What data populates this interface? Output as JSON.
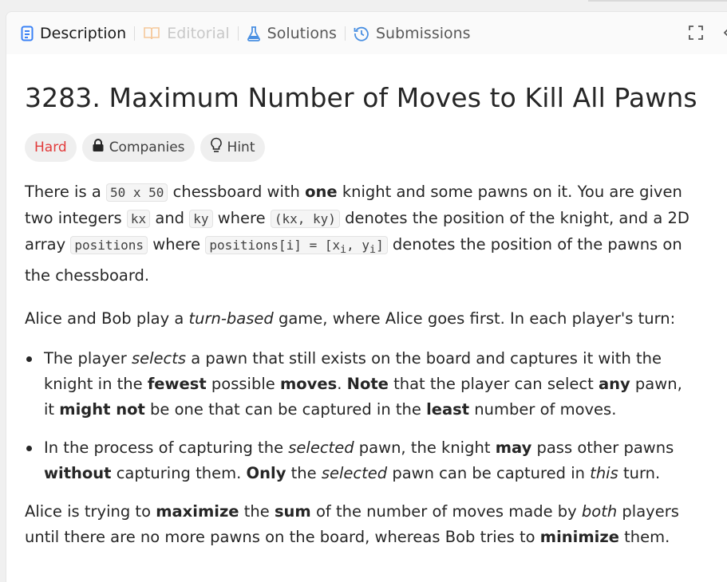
{
  "tabs": [
    {
      "label": "Description",
      "icon": "document-icon",
      "state": "active"
    },
    {
      "label": "Editorial",
      "icon": "book-icon",
      "state": "disabled"
    },
    {
      "label": "Solutions",
      "icon": "flask-icon",
      "state": "normal"
    },
    {
      "label": "Submissions",
      "icon": "history-icon",
      "state": "normal"
    }
  ],
  "problem": {
    "title": "3283. Maximum Number of Moves to Kill All Pawns",
    "difficulty": "Hard",
    "companies_label": "Companies",
    "hint_label": "Hint"
  },
  "text": {
    "p1_a": "There is a ",
    "p1_code1": "50 x 50",
    "p1_b": " chessboard with ",
    "p1_bold1": "one",
    "p1_c": " knight and some pawns on it. You are given two integers ",
    "p1_code2": "kx",
    "p1_d": " and ",
    "p1_code3": "ky",
    "p1_e": " where ",
    "p1_code4": "(kx, ky)",
    "p1_f": " denotes the position of the knight, and a 2D array ",
    "p1_code5": "positions",
    "p1_g": " where ",
    "p1_code6": "positions[i] = [x",
    "p1_sub1": "i",
    "p1_code7": ", y",
    "p1_sub2": "i",
    "p1_code8": "]",
    "p1_h": " denotes the position of the pawns on the chessboard.",
    "p2_a": "Alice and Bob play a ",
    "p2_i": "turn-based",
    "p2_b": " game, where Alice goes first. In each player's turn:",
    "b1_a": "The player ",
    "b1_i": "selects",
    "b1_b": " a pawn that still exists on the board and captures it with the knight in the ",
    "b1_bold1": "fewest",
    "b1_c": " possible ",
    "b1_bold2": "moves",
    "b1_d": ". ",
    "b1_bold3": "Note",
    "b1_e": " that the player can select ",
    "b1_bold4": "any",
    "b1_f": " pawn, it ",
    "b1_bold5": "might not",
    "b1_g": " be one that can be captured in the ",
    "b1_bold6": "least",
    "b1_h": " number of moves.",
    "b2_a": "In the process of capturing the ",
    "b2_i1": "selected",
    "b2_b": " pawn, the knight ",
    "b2_bold1": "may",
    "b2_c": " pass other pawns ",
    "b2_bold2": "without",
    "b2_d": " capturing them. ",
    "b2_bold3": "Only",
    "b2_e": " the ",
    "b2_i2": "selected",
    "b2_f": " pawn can be captured in ",
    "b2_i3": "this",
    "b2_g": " turn.",
    "p3_a": "Alice is trying to ",
    "p3_bold1": "maximize",
    "p3_b": " the ",
    "p3_bold2": "sum",
    "p3_c": " of the number of moves made by ",
    "p3_i": "both",
    "p3_d": " players until there are no more pawns on the board, whereas Bob tries to ",
    "p3_bold3": "minimize",
    "p3_e": " them."
  },
  "colors": {
    "accent_blue": "#4a90e2",
    "hard_red": "#e23b3b",
    "text": "#262626"
  }
}
